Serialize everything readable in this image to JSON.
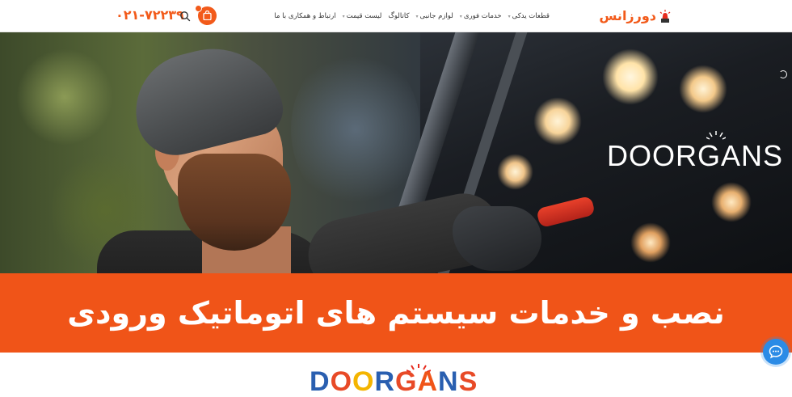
{
  "header": {
    "phone": "۰۲۱-۷۲۲۳۹",
    "logo_text": "دورزانس",
    "nav": [
      {
        "label": "قطعات یدکی",
        "has_caret": true
      },
      {
        "label": "خدمات فوری",
        "has_caret": true
      },
      {
        "label": "لوازم جانبی",
        "has_caret": true
      },
      {
        "label": "کاتالوگ",
        "has_caret": false
      },
      {
        "label": "لیست قیمت",
        "has_caret": true
      },
      {
        "label": "ارتباط و همکاری با ما",
        "has_caret": false
      }
    ],
    "icons": {
      "search": "search-icon",
      "cart": "shopping-bag-icon"
    }
  },
  "hero": {
    "brand": "DOORGANS"
  },
  "banner": {
    "title": "نصب و خدمات سیستم های اتوماتیک ورودی"
  },
  "footer_logo": {
    "text": "DOORGANS"
  },
  "colors": {
    "accent": "#f05418",
    "phone": "#f25a1a",
    "chat": "#2b8be6"
  }
}
